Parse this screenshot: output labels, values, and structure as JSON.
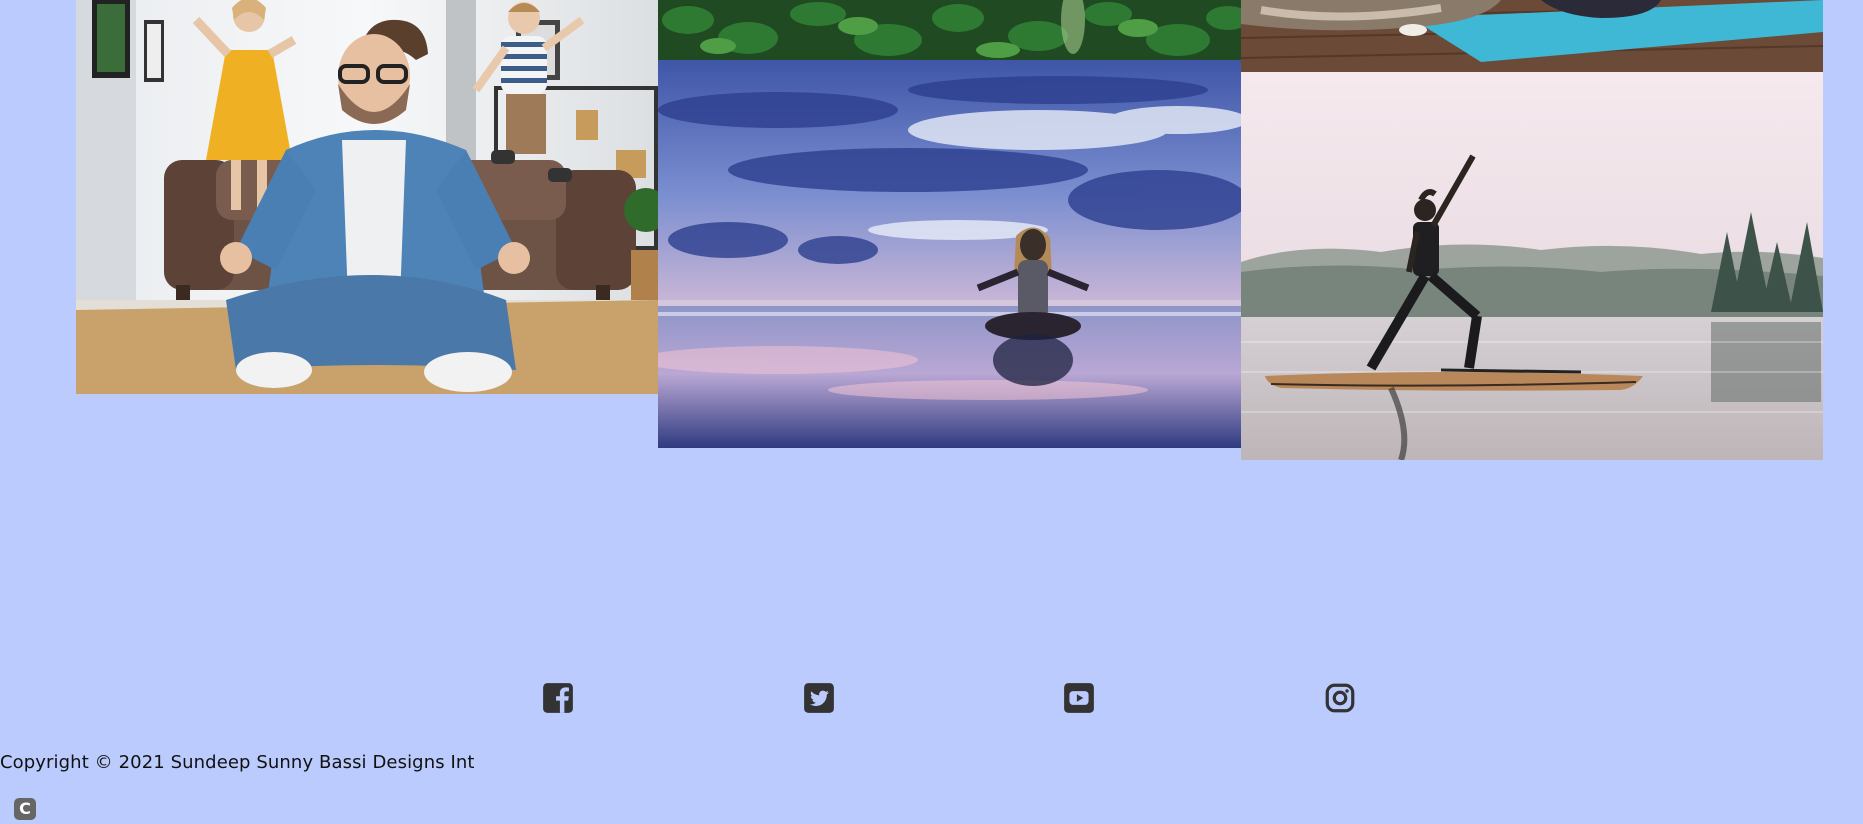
{
  "gallery": {
    "photos": [
      {
        "icon": "photo-man-meditating-with-kids"
      },
      {
        "icon": "photo-green-leaves"
      },
      {
        "icon": "photo-woman-meditating-beach"
      },
      {
        "icon": "photo-dog-on-yoga-mat"
      },
      {
        "icon": "photo-paddleboard-yoga-lake"
      }
    ]
  },
  "footer": {
    "social": [
      {
        "icon": "facebook-icon"
      },
      {
        "icon": "twitter-icon"
      },
      {
        "icon": "youtube-icon"
      },
      {
        "icon": "instagram-icon"
      }
    ],
    "copyright": "Copyright © 2021 Sundeep Sunny Bassi Designs Int",
    "badge": "C"
  },
  "colors": {
    "background": "#bbcbfd",
    "icon": "#333333",
    "text": "#111111"
  }
}
